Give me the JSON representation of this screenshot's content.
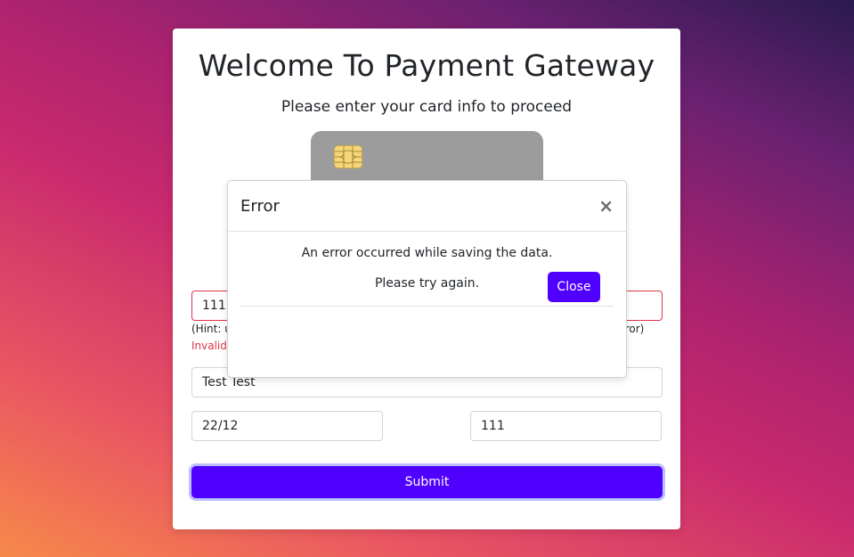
{
  "page": {
    "title": "Welcome To Payment Gateway",
    "subtitle": "Please enter your card info to proceed"
  },
  "form": {
    "card_number_value": "1111",
    "hint_left": "(Hint: u",
    "hint_right": "rror)",
    "invalid_left": "Invalid",
    "name_value": "Test Test",
    "expiry_value": "22/12",
    "cvv_value": "111",
    "submit_label": "Submit"
  },
  "modal": {
    "title": "Error",
    "close_glyph": "×",
    "message_line1": "An error occurred while saving the data.",
    "message_line2": "Please try again.",
    "close_button_label": "Close"
  },
  "colors": {
    "primary_button": "#5000ff",
    "error": "#dc3545",
    "card_gray": "#9c9c9c",
    "chip_gold": "#f5d77a"
  },
  "icons": {
    "card_chip": "sim-chip-icon",
    "modal_close": "close-icon"
  }
}
